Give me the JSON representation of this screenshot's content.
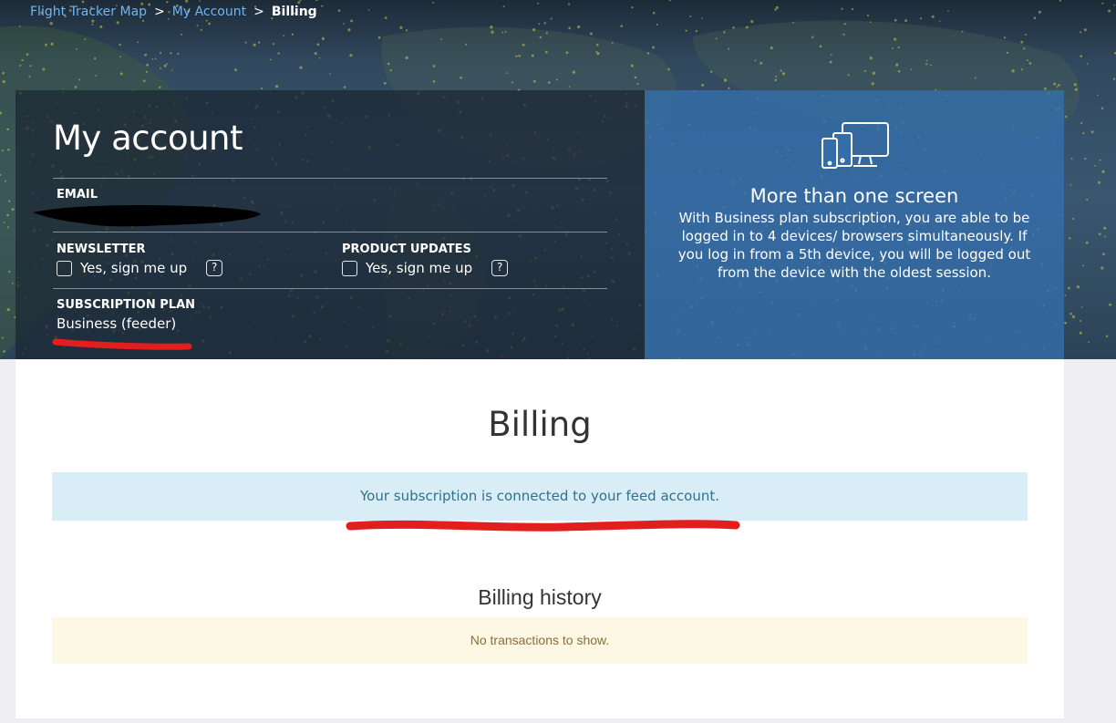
{
  "breadcrumb": {
    "items": [
      {
        "label": "Flight Tracker Map"
      },
      {
        "label": "My Account"
      }
    ],
    "separator": ">",
    "current": "Billing"
  },
  "account": {
    "title": "My account",
    "email_label": "EMAIL",
    "newsletter_label": "NEWSLETTER",
    "newsletter_option": "Yes, sign me up",
    "product_updates_label": "PRODUCT UPDATES",
    "product_updates_option": "Yes, sign me up",
    "help_glyph": "?",
    "plan_label": "SUBSCRIPTION PLAN",
    "plan_value": "Business (feeder)"
  },
  "promo": {
    "icon": "devices-icon",
    "title": "More than one screen",
    "text": "With Business plan subscription, you are able to be logged in to 4 devices/ browsers simultaneously. If you log in from a 5th device, you will be logged out from the device with the oldest session."
  },
  "billing": {
    "title": "Billing",
    "info_message": "Your subscription is connected to your feed account.",
    "history_title": "Billing history",
    "empty_message": "No transactions to show."
  },
  "colors": {
    "link": "#6fb6f2",
    "promo_bg": "#346eaa",
    "info_bg": "#d9edf7",
    "info_text": "#31708f",
    "warn_bg": "#fcf8e3",
    "warn_text": "#8a6d3b",
    "redaction": "#e31e1e"
  }
}
